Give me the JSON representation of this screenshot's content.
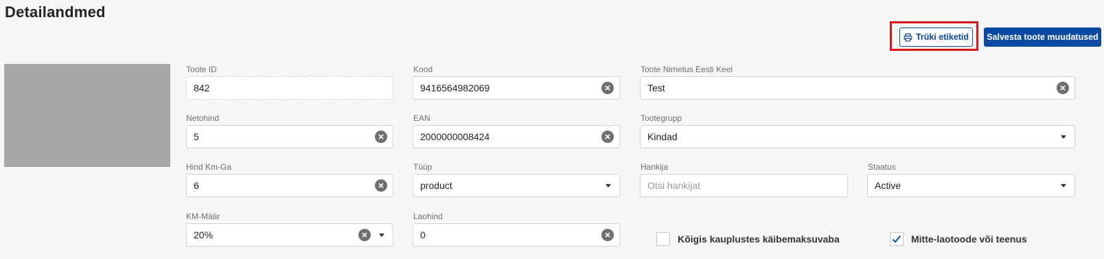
{
  "page": {
    "title": "Detailandmed"
  },
  "toolbar": {
    "print_labels": "Trüki etiketid",
    "save_changes": "Salvesta toote muudatused"
  },
  "fields": {
    "product_id": {
      "label": "Toote ID",
      "value": "842"
    },
    "code": {
      "label": "Kood",
      "value": "9416564982069"
    },
    "name_et": {
      "label": "Toote Nimetus Eesti Keel",
      "value": "Test"
    },
    "net_price": {
      "label": "Netohind",
      "value": "5"
    },
    "ean": {
      "label": "EAN",
      "value": "2000000008424"
    },
    "product_group": {
      "label": "Tootegrupp",
      "value": "Kindad"
    },
    "price_with_vat": {
      "label": "Hind Km-Ga",
      "value": "6"
    },
    "type": {
      "label": "Tüüp",
      "value": "product"
    },
    "supplier": {
      "label": "Hankija",
      "value": "",
      "placeholder": "Otsi hankijat"
    },
    "status": {
      "label": "Staatus",
      "value": "Active"
    },
    "vat_rate": {
      "label": "KM-Määr",
      "value": "20%"
    },
    "warehouse_price": {
      "label": "Laohind",
      "value": "0"
    }
  },
  "checkboxes": {
    "tax_free_all_stores": {
      "label": "Kõigis kauplustes käibemaksuvaba",
      "checked": false
    },
    "non_stock_or_service": {
      "label": "Mitte-laotoode või teenus",
      "checked": true
    }
  },
  "colors": {
    "primary": "#0b4aa2",
    "highlight": "#d8141b",
    "background": "#f6f6f6",
    "image_placeholder": "#a8a8a8"
  },
  "icons": {
    "print": "printer-icon",
    "clear": "clear-circle-icon",
    "dropdown": "chevron-down-icon",
    "check": "checkmark-icon"
  }
}
